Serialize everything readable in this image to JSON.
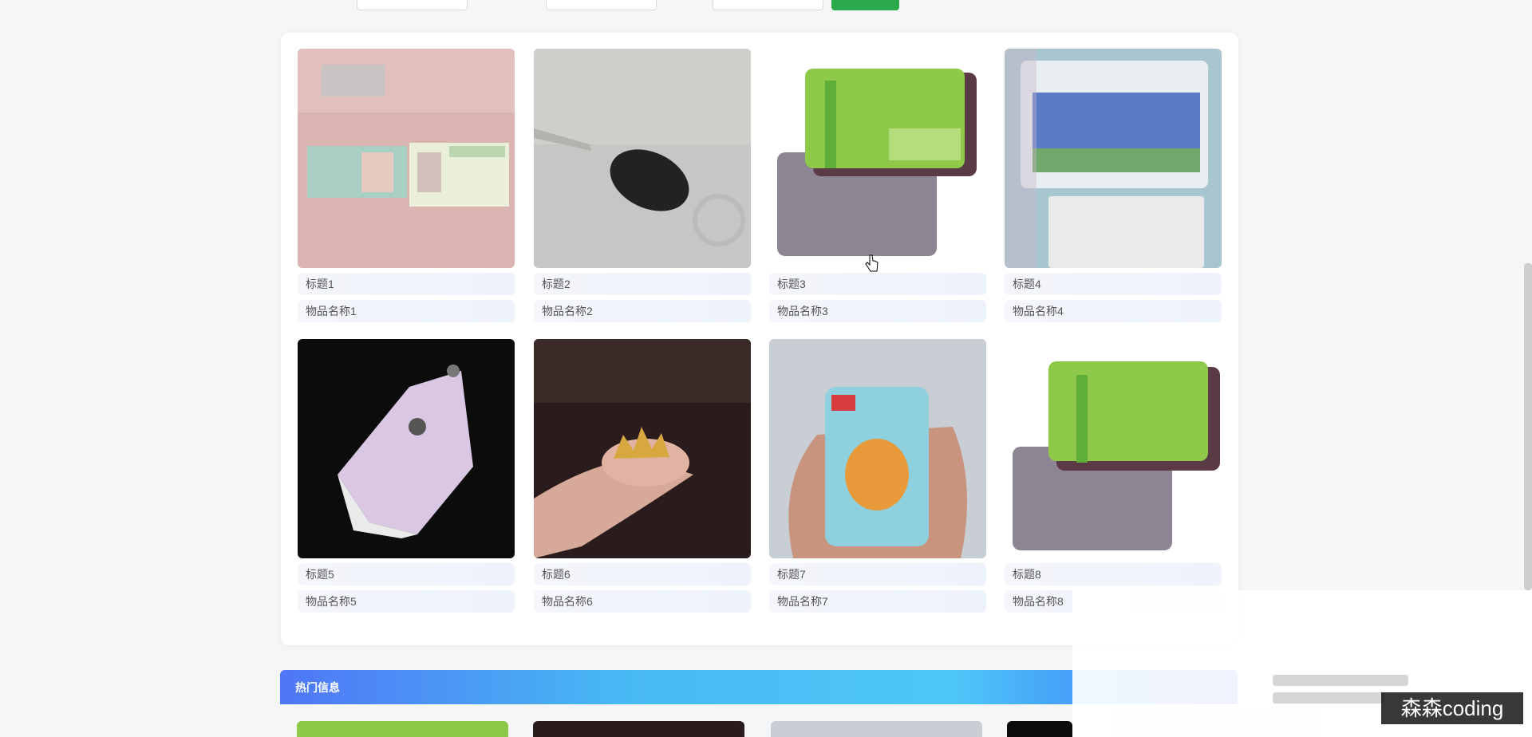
{
  "items": [
    {
      "title": "标题1",
      "name": "物品名称1",
      "image": "student-cards-photo"
    },
    {
      "title": "标题2",
      "name": "物品名称2",
      "image": "car-key-photo"
    },
    {
      "title": "标题3",
      "name": "物品名称3",
      "image": "transit-card-photo"
    },
    {
      "title": "标题4",
      "name": "物品名称4",
      "image": "transit-card-package-photo"
    },
    {
      "title": "标题5",
      "name": "物品名称5",
      "image": "leather-key-case-photo"
    },
    {
      "title": "标题6",
      "name": "物品名称6",
      "image": "crown-ring-photo"
    },
    {
      "title": "标题7",
      "name": "物品名称7",
      "image": "garfield-card-photo"
    },
    {
      "title": "标题8",
      "name": "物品名称8",
      "image": "transit-card-photo"
    }
  ],
  "hot_section": {
    "label": "热门信息"
  },
  "watermark": "森森coding",
  "colors": {
    "search_button": "#2aa84a",
    "hot_banner_start": "#4f76f7",
    "hot_banner_mid": "#4ec7f8"
  }
}
